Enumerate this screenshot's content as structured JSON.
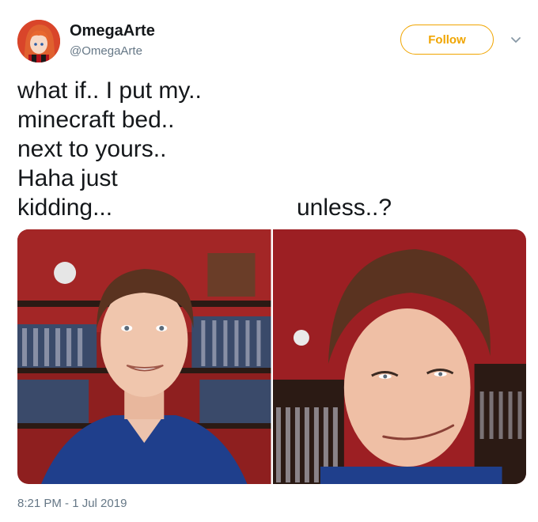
{
  "author": {
    "display_name": "OmegaArte",
    "handle": "@OmegaArte",
    "avatar_icon": "anime-avatar"
  },
  "header": {
    "follow_label": "Follow",
    "follow_color": "#f0a500",
    "menu_icon": "chevron-down-icon"
  },
  "tweet": {
    "lines": [
      "what if.. I put my..",
      "minecraft bed..",
      "next to yours..",
      "Haha just",
      "kidding..."
    ],
    "aside": "unless..?",
    "timestamp": "8:21 PM - 1 Jul 2019"
  },
  "media": {
    "photos": [
      {
        "description_icon": "smiling-man-photo"
      },
      {
        "description_icon": "smirking-man-photo"
      }
    ]
  }
}
